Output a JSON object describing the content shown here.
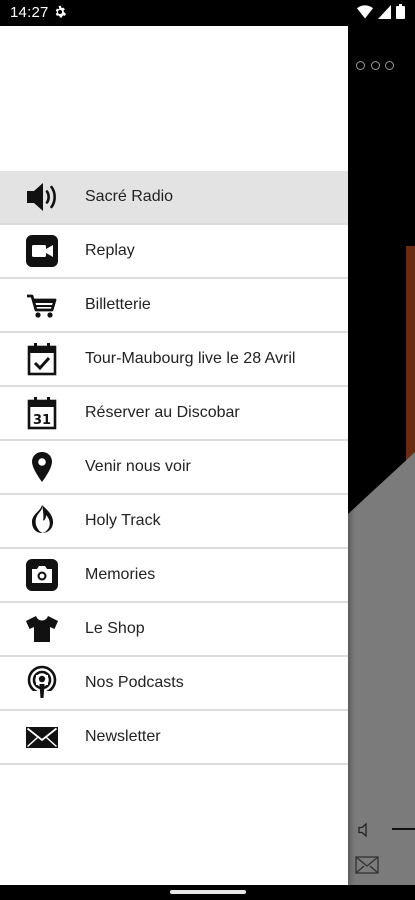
{
  "status_bar": {
    "time": "14:27",
    "icons": [
      "gear-icon",
      "wifi-icon",
      "signal-icon",
      "battery-icon"
    ]
  },
  "background_app": {
    "icons": [
      "more-options-icon",
      "speaker-icon",
      "mail-icon"
    ]
  },
  "drawer": {
    "items": [
      {
        "label": "Sacré Radio",
        "icon": "speaker-icon",
        "active": true
      },
      {
        "label": "Replay",
        "icon": "video-camera-icon",
        "active": false
      },
      {
        "label": "Billetterie",
        "icon": "shopping-cart-icon",
        "active": false
      },
      {
        "label": "Tour-Maubourg live le 28 Avril",
        "icon": "calendar-check-icon",
        "active": false
      },
      {
        "label": "Réserver au Discobar",
        "icon": "calendar-31-icon",
        "active": false
      },
      {
        "label": "Venir nous voir",
        "icon": "map-pin-icon",
        "active": false
      },
      {
        "label": "Holy Track",
        "icon": "flame-icon",
        "active": false
      },
      {
        "label": "Memories",
        "icon": "camera-icon",
        "active": false
      },
      {
        "label": "Le Shop",
        "icon": "tshirt-icon",
        "active": false
      },
      {
        "label": "Nos Podcasts",
        "icon": "podcast-icon",
        "active": false
      },
      {
        "label": "Newsletter",
        "icon": "envelope-icon",
        "active": false
      }
    ],
    "calendar_day": "31"
  },
  "colors": {
    "drawer_bg": "#ffffff",
    "active_item_bg": "#e3e3e3",
    "divider": "#dcdcdc",
    "background_grey": "#7b7b7b",
    "background_orange": "#6b2a12"
  }
}
